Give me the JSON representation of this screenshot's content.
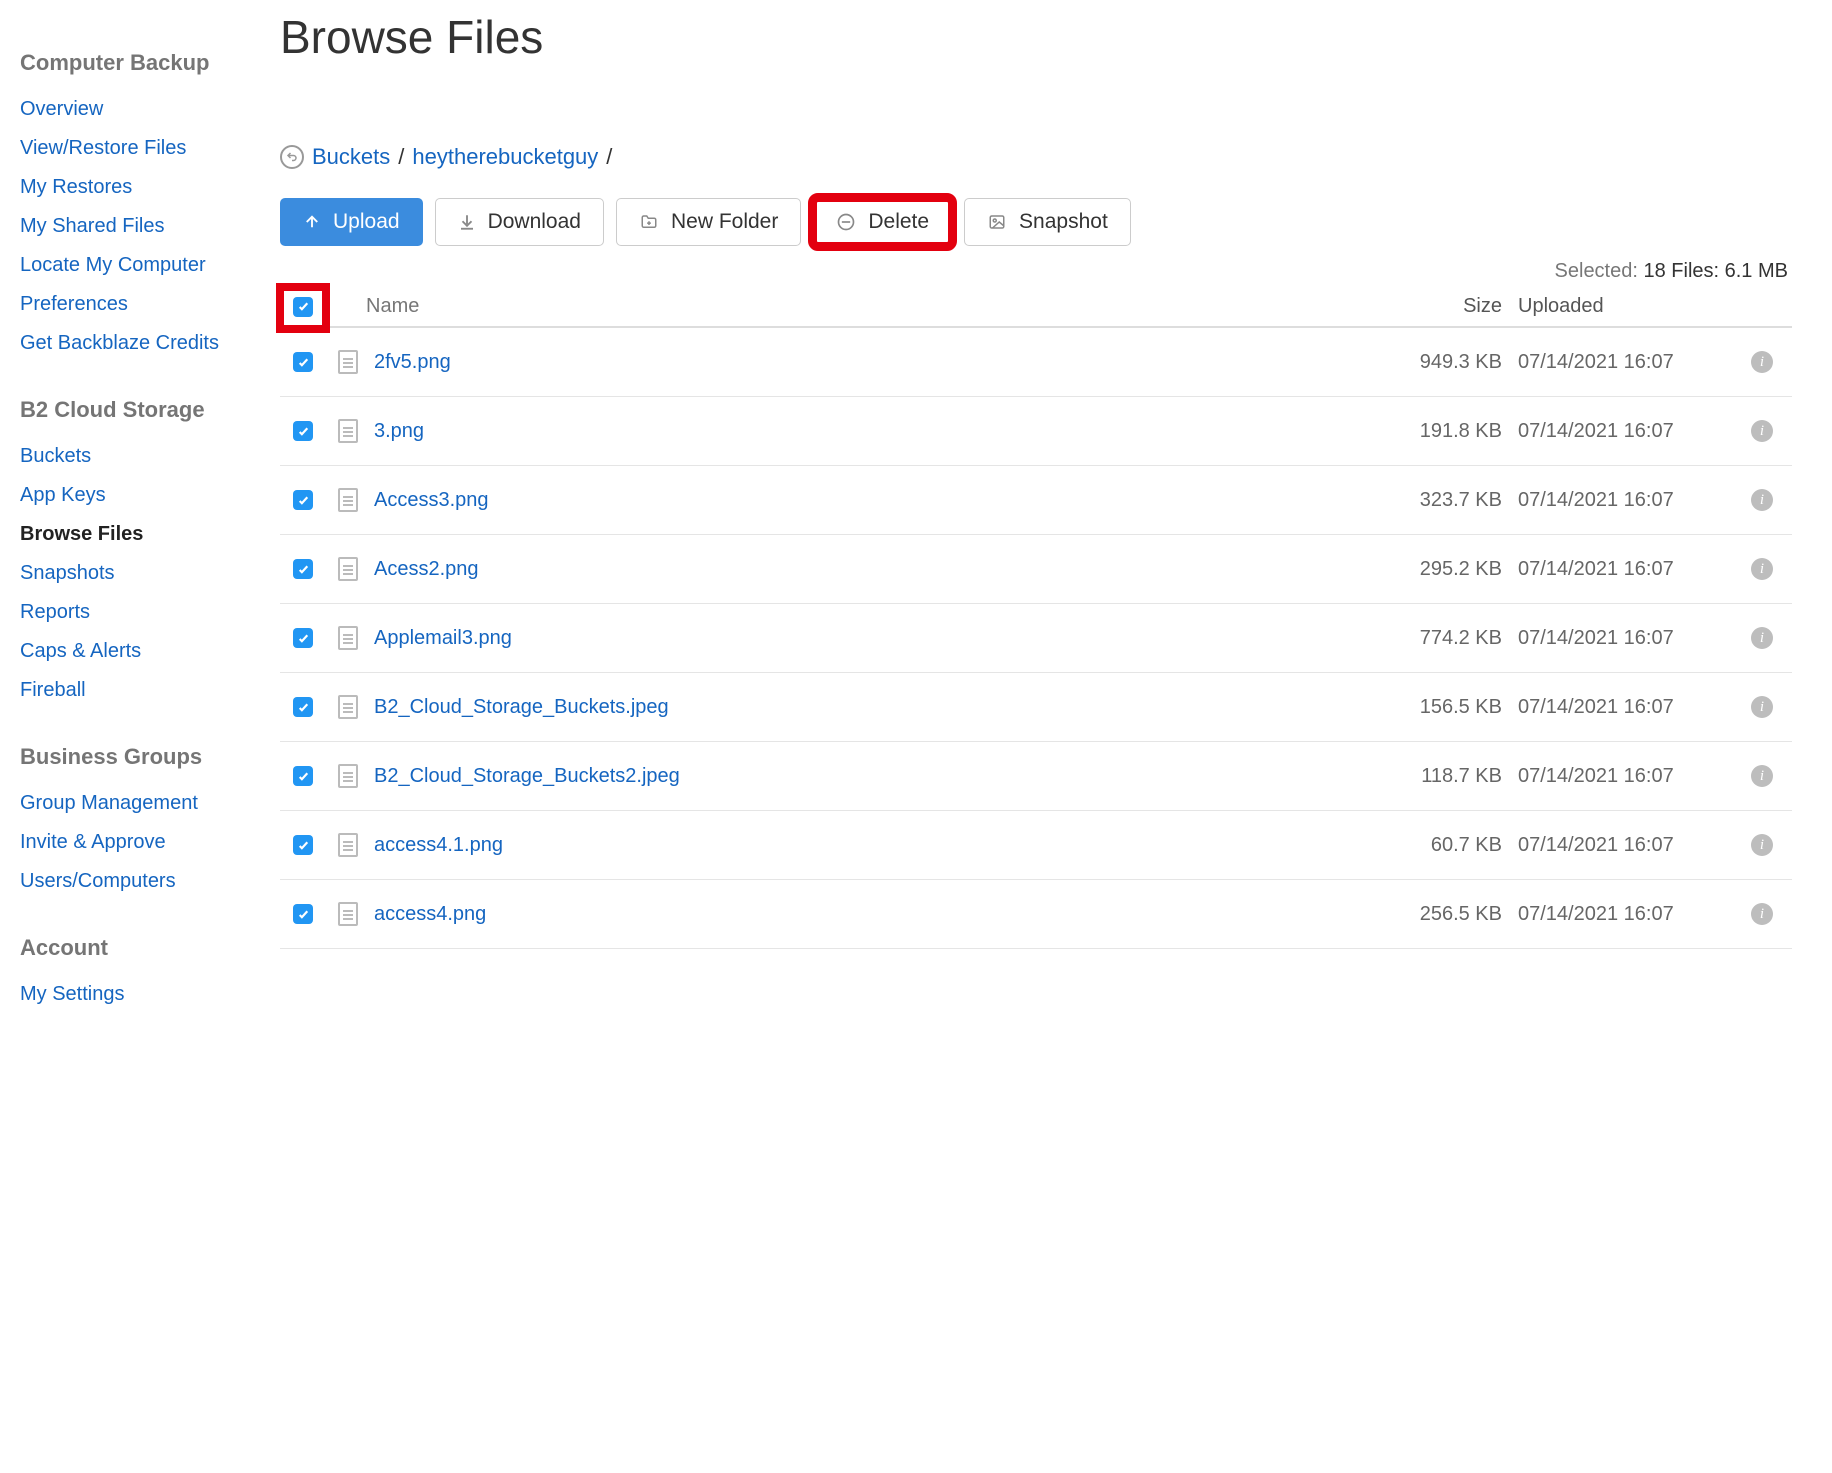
{
  "page": {
    "title": "Browse Files"
  },
  "sidebar": {
    "sections": [
      {
        "heading": "Computer Backup",
        "items": [
          {
            "label": "Overview",
            "active": false
          },
          {
            "label": "View/Restore Files",
            "active": false
          },
          {
            "label": "My Restores",
            "active": false
          },
          {
            "label": "My Shared Files",
            "active": false
          },
          {
            "label": "Locate My Computer",
            "active": false
          },
          {
            "label": "Preferences",
            "active": false
          },
          {
            "label": "Get Backblaze Credits",
            "active": false
          }
        ]
      },
      {
        "heading": "B2 Cloud Storage",
        "items": [
          {
            "label": "Buckets",
            "active": false
          },
          {
            "label": "App Keys",
            "active": false
          },
          {
            "label": "Browse Files",
            "active": true
          },
          {
            "label": "Snapshots",
            "active": false
          },
          {
            "label": "Reports",
            "active": false
          },
          {
            "label": "Caps & Alerts",
            "active": false
          },
          {
            "label": "Fireball",
            "active": false
          }
        ]
      },
      {
        "heading": "Business Groups",
        "items": [
          {
            "label": "Group Management",
            "active": false
          },
          {
            "label": "Invite & Approve",
            "active": false
          },
          {
            "label": "Users/Computers",
            "active": false
          }
        ]
      },
      {
        "heading": "Account",
        "items": [
          {
            "label": "My Settings",
            "active": false
          }
        ]
      }
    ]
  },
  "breadcrumb": {
    "root": "Buckets",
    "bucket": "heytherebucketguy",
    "sep": "/"
  },
  "toolbar": {
    "upload": "Upload",
    "download": "Download",
    "newFolder": "New Folder",
    "delete": "Delete",
    "snapshot": "Snapshot"
  },
  "selection": {
    "label": "Selected:",
    "value": "18 Files: 6.1 MB"
  },
  "tableHeaders": {
    "name": "Name",
    "size": "Size",
    "uploaded": "Uploaded"
  },
  "files": [
    {
      "checked": true,
      "name": "2fv5.png",
      "size": "949.3 KB",
      "uploaded": "07/14/2021 16:07"
    },
    {
      "checked": true,
      "name": "3.png",
      "size": "191.8 KB",
      "uploaded": "07/14/2021 16:07"
    },
    {
      "checked": true,
      "name": "Access3.png",
      "size": "323.7 KB",
      "uploaded": "07/14/2021 16:07"
    },
    {
      "checked": true,
      "name": "Acess2.png",
      "size": "295.2 KB",
      "uploaded": "07/14/2021 16:07"
    },
    {
      "checked": true,
      "name": "Applemail3.png",
      "size": "774.2 KB",
      "uploaded": "07/14/2021 16:07"
    },
    {
      "checked": true,
      "name": "B2_Cloud_Storage_Buckets.jpeg",
      "size": "156.5 KB",
      "uploaded": "07/14/2021 16:07"
    },
    {
      "checked": true,
      "name": "B2_Cloud_Storage_Buckets2.jpeg",
      "size": "118.7 KB",
      "uploaded": "07/14/2021 16:07"
    },
    {
      "checked": true,
      "name": "access4.1.png",
      "size": "60.7 KB",
      "uploaded": "07/14/2021 16:07"
    },
    {
      "checked": true,
      "name": "access4.png",
      "size": "256.5 KB",
      "uploaded": "07/14/2021 16:07"
    }
  ]
}
